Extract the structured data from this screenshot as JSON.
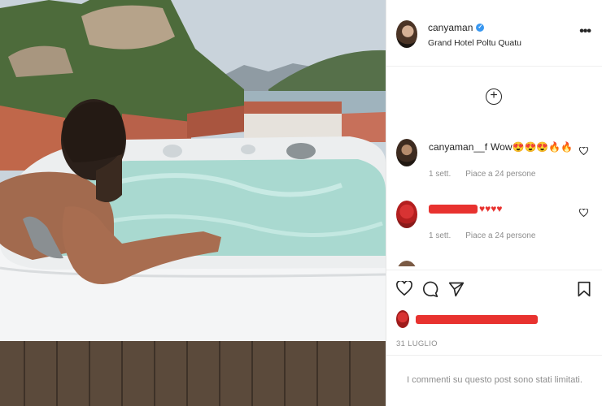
{
  "post": {
    "username": "canyaman",
    "verified_mark": "✓",
    "location": "Grand Hotel Poltu Quatu",
    "more_label": "•••",
    "load_more_label": "+",
    "date": "31 LUGLIO",
    "comments_limited_text": "I commenti su questo post sono stati limitati."
  },
  "comments": [
    {
      "username": "canyaman__f",
      "text": "Wow😍😍😍🔥🔥",
      "age": "1 sett.",
      "likes": "Piace a 24 persone"
    },
    {
      "username": "",
      "text": "♥♥♥♥",
      "age": "1 sett.",
      "likes": "Piace a 24 persone"
    }
  ],
  "icons": {
    "heart": "heart-icon",
    "comment": "comment-icon",
    "share": "share-icon",
    "bookmark": "bookmark-icon",
    "more": "more-icon",
    "add": "add-comment-icon"
  },
  "colors": {
    "redaction": "#e8322f",
    "verified": "#3897f0",
    "text": "#262626",
    "muted": "#8e8e8e"
  }
}
